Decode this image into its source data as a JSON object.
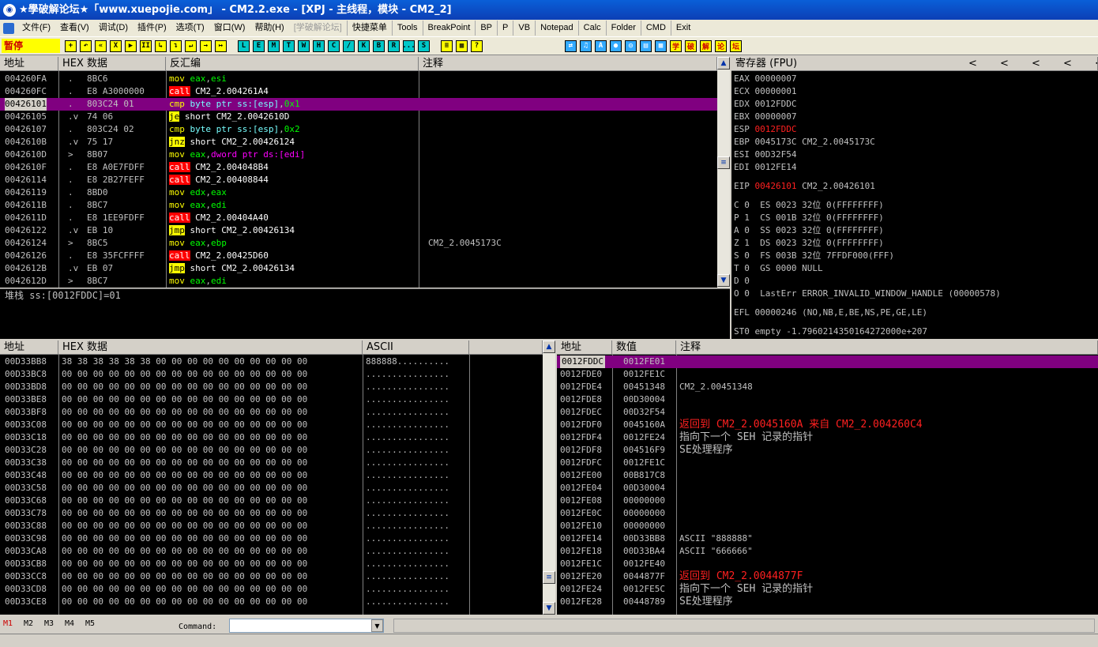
{
  "window": {
    "title": "★學破解论坛★「www.xuepojie.com」 - CM2.2.exe - [XPJ - 主线程，模块 - CM2_2]"
  },
  "menu": {
    "items": [
      "文件(F)",
      "查看(V)",
      "调试(D)",
      "插件(P)",
      "选项(T)",
      "窗口(W)",
      "帮助(H)"
    ],
    "disabled_item": "[学破解论坛]",
    "toolbar_items": [
      "快捷菜单",
      "Tools",
      "BreakPoint",
      "BP",
      "P",
      "VB",
      "Notepad",
      "Calc",
      "Folder",
      "CMD",
      "Exit"
    ]
  },
  "toolbar": {
    "status": "暂停",
    "buttons_left": [
      "+",
      "↶",
      "«",
      "X",
      "▶",
      "II",
      "↳",
      "↴",
      "↵",
      "→",
      "↦"
    ],
    "buttons_letters": [
      "L",
      "E",
      "M",
      "T",
      "W",
      "H",
      "C",
      "/",
      "K",
      "B",
      "R",
      "...",
      "S"
    ],
    "buttons_grid": [
      "≡",
      "▦",
      "?"
    ],
    "buttons_right": [
      "⇄",
      "♫",
      "A",
      "●",
      "◎",
      "▤",
      "▦"
    ],
    "buttons_cn": [
      "学",
      "破",
      "解",
      "论",
      "坛"
    ]
  },
  "disasm": {
    "headers": [
      "地址",
      "HEX 数据",
      "反汇编",
      "注释"
    ],
    "rows": [
      {
        "addr": "004260FA",
        "mark": ".",
        "hex": "8BC6",
        "asm": [
          {
            "t": "mov",
            "c": "yel"
          },
          {
            "t": " "
          },
          {
            "t": "eax",
            "c": "grn"
          },
          {
            "t": ","
          },
          {
            "t": "esi",
            "c": "grn"
          }
        ],
        "comment": ""
      },
      {
        "addr": "004260FC",
        "mark": ".",
        "hex": "E8 A3000000",
        "asm": [
          {
            "t": "call",
            "c": "boxred"
          },
          {
            "t": " CM2_2.004261A4",
            "c": "wht"
          }
        ],
        "comment": ""
      },
      {
        "addr": "00426101",
        "mark": ".",
        "hex": "803C24 01",
        "asm": [
          {
            "t": "cmp",
            "c": "yel"
          },
          {
            "t": " "
          },
          {
            "t": "byte ptr ss:[esp]",
            "c": "cyan"
          },
          {
            "t": ","
          },
          {
            "t": "0x1",
            "c": "grn"
          }
        ],
        "comment": "",
        "selected": true
      },
      {
        "addr": "00426105",
        "mark": ".v",
        "hex": "74 06",
        "asm": [
          {
            "t": "je",
            "c": "boxyel"
          },
          {
            "t": " short CM2_2.0042610D",
            "c": "wht"
          }
        ],
        "comment": ""
      },
      {
        "addr": "00426107",
        "mark": ".",
        "hex": "803C24 02",
        "asm": [
          {
            "t": "cmp",
            "c": "yel"
          },
          {
            "t": " "
          },
          {
            "t": "byte ptr ss:[esp]",
            "c": "cyan"
          },
          {
            "t": ","
          },
          {
            "t": "0x2",
            "c": "grn"
          }
        ],
        "comment": ""
      },
      {
        "addr": "0042610B",
        "mark": ".v",
        "hex": "75 17",
        "asm": [
          {
            "t": "jnz",
            "c": "boxyel"
          },
          {
            "t": " short CM2_2.00426124",
            "c": "wht"
          }
        ],
        "comment": ""
      },
      {
        "addr": "0042610D",
        "mark": ">",
        "hex": "8B07",
        "asm": [
          {
            "t": "mov",
            "c": "yel"
          },
          {
            "t": " "
          },
          {
            "t": "eax",
            "c": "grn"
          },
          {
            "t": ","
          },
          {
            "t": "dword ptr ds:[edi]",
            "c": "mag"
          }
        ],
        "comment": ""
      },
      {
        "addr": "0042610F",
        "mark": ".",
        "hex": "E8 A0E7FDFF",
        "asm": [
          {
            "t": "call",
            "c": "boxred"
          },
          {
            "t": " CM2_2.004048B4",
            "c": "wht"
          }
        ],
        "comment": ""
      },
      {
        "addr": "00426114",
        "mark": ".",
        "hex": "E8 2B27FEFF",
        "asm": [
          {
            "t": "call",
            "c": "boxred"
          },
          {
            "t": " CM2_2.00408844",
            "c": "wht"
          }
        ],
        "comment": ""
      },
      {
        "addr": "00426119",
        "mark": ".",
        "hex": "8BD0",
        "asm": [
          {
            "t": "mov",
            "c": "yel"
          },
          {
            "t": " "
          },
          {
            "t": "edx",
            "c": "grn"
          },
          {
            "t": ","
          },
          {
            "t": "eax",
            "c": "grn"
          }
        ],
        "comment": ""
      },
      {
        "addr": "0042611B",
        "mark": ".",
        "hex": "8BC7",
        "asm": [
          {
            "t": "mov",
            "c": "yel"
          },
          {
            "t": " "
          },
          {
            "t": "eax",
            "c": "grn"
          },
          {
            "t": ","
          },
          {
            "t": "edi",
            "c": "grn"
          }
        ],
        "comment": ""
      },
      {
        "addr": "0042611D",
        "mark": ".",
        "hex": "E8 1EE9FDFF",
        "asm": [
          {
            "t": "call",
            "c": "boxred"
          },
          {
            "t": " CM2_2.00404A40",
            "c": "wht"
          }
        ],
        "comment": ""
      },
      {
        "addr": "00426122",
        "mark": ".v",
        "hex": "EB 10",
        "asm": [
          {
            "t": "jmp",
            "c": "boxyel"
          },
          {
            "t": " short CM2_2.00426134",
            "c": "wht"
          }
        ],
        "comment": ""
      },
      {
        "addr": "00426124",
        "mark": ">",
        "hex": "8BC5",
        "asm": [
          {
            "t": "mov",
            "c": "yel"
          },
          {
            "t": " "
          },
          {
            "t": "eax",
            "c": "grn"
          },
          {
            "t": ","
          },
          {
            "t": "ebp",
            "c": "grn"
          }
        ],
        "comment": "CM2_2.0045173C"
      },
      {
        "addr": "00426126",
        "mark": ".",
        "hex": "E8 35FCFFFF",
        "asm": [
          {
            "t": "call",
            "c": "boxred"
          },
          {
            "t": " CM2_2.00425D60",
            "c": "wht"
          }
        ],
        "comment": ""
      },
      {
        "addr": "0042612B",
        "mark": ".v",
        "hex": "EB 07",
        "asm": [
          {
            "t": "jmp",
            "c": "boxyel"
          },
          {
            "t": " short CM2_2.00426134",
            "c": "wht"
          }
        ],
        "comment": ""
      },
      {
        "addr": "0042612D",
        "mark": ">",
        "hex": "8BC7",
        "asm": [
          {
            "t": "mov",
            "c": "yel"
          },
          {
            "t": " "
          },
          {
            "t": "eax",
            "c": "grn"
          },
          {
            "t": ","
          },
          {
            "t": "edi",
            "c": "grn"
          }
        ],
        "comment": ""
      }
    ]
  },
  "info": {
    "text": "堆栈 ss:[0012FDDC]=01"
  },
  "registers": {
    "header": "寄存器 (FPU)",
    "nav": [
      "<",
      "<",
      "<",
      "<",
      "<"
    ],
    "lines": [
      [
        {
          "t": "EAX 00000007"
        }
      ],
      [
        {
          "t": "ECX 00000001"
        }
      ],
      [
        {
          "t": "EDX 0012FDDC"
        }
      ],
      [
        {
          "t": "EBX 00000007"
        }
      ],
      [
        {
          "t": "ESP "
        },
        {
          "t": "0012FDDC",
          "c": "red"
        }
      ],
      [
        {
          "t": "EBP 0045173C CM2_2.0045173C"
        }
      ],
      [
        {
          "t": "ESI 00D32F54"
        }
      ],
      [
        {
          "t": "EDI 0012FE14"
        }
      ],
      [
        {
          "t": ""
        }
      ],
      [
        {
          "t": "EIP "
        },
        {
          "t": "00426101",
          "c": "red"
        },
        {
          "t": " CM2_2.00426101"
        }
      ],
      [
        {
          "t": ""
        }
      ],
      [
        {
          "t": "C 0  ES 0023 32位 0(FFFFFFFF)"
        }
      ],
      [
        {
          "t": "P 1  CS 001B 32位 0(FFFFFFFF)"
        }
      ],
      [
        {
          "t": "A 0  SS 0023 32位 0(FFFFFFFF)"
        }
      ],
      [
        {
          "t": "Z 1  DS 0023 32位 0(FFFFFFFF)"
        }
      ],
      [
        {
          "t": "S 0  FS 003B 32位 7FFDF000(FFF)"
        }
      ],
      [
        {
          "t": "T 0  GS 0000 NULL"
        }
      ],
      [
        {
          "t": "D 0"
        }
      ],
      [
        {
          "t": "O 0  LastErr ERROR_INVALID_WINDOW_HANDLE (00000578)"
        }
      ],
      [
        {
          "t": ""
        }
      ],
      [
        {
          "t": "EFL 00000246 (NO,NB,E,BE,NS,PE,GE,LE)"
        }
      ],
      [
        {
          "t": ""
        }
      ],
      [
        {
          "t": "ST0 empty -1.7960214350164272000e+207"
        }
      ]
    ]
  },
  "dump": {
    "headers": [
      "地址",
      "HEX 数据",
      "ASCII"
    ],
    "rows": [
      {
        "addr": "00D33BB8",
        "hex": "38 38 38 38 38 38 00 00 00 00 00 00 00 00 00 00",
        "ascii": "888888.........."
      },
      {
        "addr": "00D33BC8",
        "hex": "00 00 00 00 00 00 00 00 00 00 00 00 00 00 00 00",
        "ascii": "................"
      },
      {
        "addr": "00D33BD8",
        "hex": "00 00 00 00 00 00 00 00 00 00 00 00 00 00 00 00",
        "ascii": "................"
      },
      {
        "addr": "00D33BE8",
        "hex": "00 00 00 00 00 00 00 00 00 00 00 00 00 00 00 00",
        "ascii": "................"
      },
      {
        "addr": "00D33BF8",
        "hex": "00 00 00 00 00 00 00 00 00 00 00 00 00 00 00 00",
        "ascii": "................"
      },
      {
        "addr": "00D33C08",
        "hex": "00 00 00 00 00 00 00 00 00 00 00 00 00 00 00 00",
        "ascii": "................"
      },
      {
        "addr": "00D33C18",
        "hex": "00 00 00 00 00 00 00 00 00 00 00 00 00 00 00 00",
        "ascii": "................"
      },
      {
        "addr": "00D33C28",
        "hex": "00 00 00 00 00 00 00 00 00 00 00 00 00 00 00 00",
        "ascii": "................"
      },
      {
        "addr": "00D33C38",
        "hex": "00 00 00 00 00 00 00 00 00 00 00 00 00 00 00 00",
        "ascii": "................"
      },
      {
        "addr": "00D33C48",
        "hex": "00 00 00 00 00 00 00 00 00 00 00 00 00 00 00 00",
        "ascii": "................"
      },
      {
        "addr": "00D33C58",
        "hex": "00 00 00 00 00 00 00 00 00 00 00 00 00 00 00 00",
        "ascii": "................"
      },
      {
        "addr": "00D33C68",
        "hex": "00 00 00 00 00 00 00 00 00 00 00 00 00 00 00 00",
        "ascii": "................"
      },
      {
        "addr": "00D33C78",
        "hex": "00 00 00 00 00 00 00 00 00 00 00 00 00 00 00 00",
        "ascii": "................"
      },
      {
        "addr": "00D33C88",
        "hex": "00 00 00 00 00 00 00 00 00 00 00 00 00 00 00 00",
        "ascii": "................"
      },
      {
        "addr": "00D33C98",
        "hex": "00 00 00 00 00 00 00 00 00 00 00 00 00 00 00 00",
        "ascii": "................"
      },
      {
        "addr": "00D33CA8",
        "hex": "00 00 00 00 00 00 00 00 00 00 00 00 00 00 00 00",
        "ascii": "................"
      },
      {
        "addr": "00D33CB8",
        "hex": "00 00 00 00 00 00 00 00 00 00 00 00 00 00 00 00",
        "ascii": "................"
      },
      {
        "addr": "00D33CC8",
        "hex": "00 00 00 00 00 00 00 00 00 00 00 00 00 00 00 00",
        "ascii": "................"
      },
      {
        "addr": "00D33CD8",
        "hex": "00 00 00 00 00 00 00 00 00 00 00 00 00 00 00 00",
        "ascii": "................"
      },
      {
        "addr": "00D33CE8",
        "hex": "00 00 00 00 00 00 00 00 00 00 00 00 00 00 00 00",
        "ascii": "................"
      }
    ]
  },
  "stack": {
    "headers": [
      "地址",
      "数值",
      "注释"
    ],
    "rows": [
      {
        "addr": "0012FDDC",
        "val": "0012FE01",
        "comment": "",
        "selected": true
      },
      {
        "addr": "0012FDE0",
        "val": "0012FE1C",
        "comment": ""
      },
      {
        "addr": "0012FDE4",
        "val": "00451348",
        "comment": "CM2_2.00451348"
      },
      {
        "addr": "0012FDE8",
        "val": "00D30004",
        "comment": ""
      },
      {
        "addr": "0012FDEC",
        "val": "00D32F54",
        "comment": ""
      },
      {
        "addr": "0012FDF0",
        "val": "0045160A",
        "comment": "返回到 CM2_2.0045160A 来自 CM2_2.004260C4",
        "red": true
      },
      {
        "addr": "0012FDF4",
        "val": "0012FE24",
        "comment": "指向下一个 SEH 记录的指针"
      },
      {
        "addr": "0012FDF8",
        "val": "004516F9",
        "comment": "SE处理程序"
      },
      {
        "addr": "0012FDFC",
        "val": "0012FE1C",
        "comment": ""
      },
      {
        "addr": "0012FE00",
        "val": "00B817C8",
        "comment": ""
      },
      {
        "addr": "0012FE04",
        "val": "00D30004",
        "comment": ""
      },
      {
        "addr": "0012FE08",
        "val": "00000000",
        "comment": ""
      },
      {
        "addr": "0012FE0C",
        "val": "00000000",
        "comment": ""
      },
      {
        "addr": "0012FE10",
        "val": "00000000",
        "comment": ""
      },
      {
        "addr": "0012FE14",
        "val": "00D33BB8",
        "comment": "ASCII \"888888\""
      },
      {
        "addr": "0012FE18",
        "val": "00D33BA4",
        "comment": "ASCII \"666666\""
      },
      {
        "addr": "0012FE1C",
        "val": "0012FE40",
        "comment": ""
      },
      {
        "addr": "0012FE20",
        "val": "0044877F",
        "comment": "返回到 CM2_2.0044877F",
        "red": true
      },
      {
        "addr": "0012FE24",
        "val": "0012FE5C",
        "comment": "指向下一个 SEH 记录的指针"
      },
      {
        "addr": "0012FE28",
        "val": "00448789",
        "comment": "SE处理程序"
      }
    ]
  },
  "bottom": {
    "tabs": [
      "M1",
      "M2",
      "M3",
      "M4",
      "M5"
    ],
    "command_label": "Command:",
    "command_value": ""
  },
  "colors": {
    "selection": "#800080",
    "titlebar": "#0c3fb5",
    "background": "#000000",
    "text": "#c0c0c0"
  }
}
